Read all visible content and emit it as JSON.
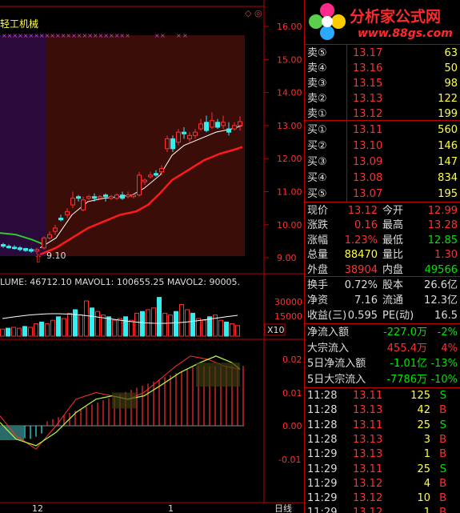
{
  "stock_name": "轻工机械",
  "logo": {
    "title": "分析家公式网",
    "url": "www.88gs.com"
  },
  "price_axis": [
    "16.00",
    "15.00",
    "14.00",
    "13.00",
    "12.00",
    "11.00",
    "10.00",
    "9.00"
  ],
  "low_marker": "9.10",
  "volume_header": "LUME: 46712.10  MAVOL1: 100655.25  MAVOL2: 90005.",
  "volume_axis": [
    "30000",
    "15000"
  ],
  "volume_unit": "X10",
  "indicator_axis": [
    "0.02",
    "0.01",
    "0.00",
    "-0.01"
  ],
  "date_labels": [
    "12",
    "1"
  ],
  "period_label": "日线",
  "order_book": {
    "asks": [
      {
        "label": "卖⑤",
        "price": "13.17",
        "vol": "63"
      },
      {
        "label": "卖④",
        "price": "13.16",
        "vol": "50"
      },
      {
        "label": "卖③",
        "price": "13.15",
        "vol": "98"
      },
      {
        "label": "卖②",
        "price": "13.13",
        "vol": "122"
      },
      {
        "label": "卖①",
        "price": "13.12",
        "vol": "199"
      }
    ],
    "bids": [
      {
        "label": "买①",
        "price": "13.11",
        "vol": "560"
      },
      {
        "label": "买②",
        "price": "13.10",
        "vol": "146"
      },
      {
        "label": "买③",
        "price": "13.09",
        "vol": "147"
      },
      {
        "label": "买④",
        "price": "13.08",
        "vol": "834"
      },
      {
        "label": "买⑤",
        "price": "13.07",
        "vol": "195"
      }
    ]
  },
  "quote": [
    {
      "l1": "现价",
      "v1": "13.12",
      "l2": "今开",
      "v2": "12.99"
    },
    {
      "l1": "涨跌",
      "v1": "0.16",
      "l2": "最高",
      "v2": "13.28"
    },
    {
      "l1": "涨幅",
      "v1": "1.23%",
      "l2": "最低",
      "v2": "12.85"
    },
    {
      "l1": "总量",
      "v1": "88470",
      "l2": "量比",
      "v2": "1.30"
    },
    {
      "l1": "外盘",
      "v1": "38904",
      "l2": "内盘",
      "v2": "49566"
    }
  ],
  "fundamentals": [
    {
      "l1": "换手",
      "v1": "0.72%",
      "l2": "股本",
      "v2": "26.6亿"
    },
    {
      "l1": "净资",
      "v1": "7.16",
      "l2": "流通",
      "v2": "12.3亿"
    },
    {
      "l1": "收益(三)",
      "v1": "0.595",
      "l2": "PE(动)",
      "v2": "16.5"
    }
  ],
  "flows": [
    {
      "label": "净流入额",
      "value": "-227.0万",
      "pct": "-2%"
    },
    {
      "label": "大宗流入",
      "value": "455.4万",
      "pct": "4%"
    },
    {
      "label": "5日净流入额",
      "value": "-1.01亿",
      "pct": "-13%"
    },
    {
      "label": "5日大宗流入",
      "value": "-7786万",
      "pct": "-10%"
    }
  ],
  "ticks": [
    {
      "time": "11:28",
      "price": "13.11",
      "vol": "125",
      "side": "S"
    },
    {
      "time": "11:28",
      "price": "13.13",
      "vol": "42",
      "side": "B"
    },
    {
      "time": "11:28",
      "price": "13.11",
      "vol": "25",
      "side": "S"
    },
    {
      "time": "11:28",
      "price": "13.13",
      "vol": "3",
      "side": "B"
    },
    {
      "time": "11:29",
      "price": "13.13",
      "vol": "1",
      "side": "B"
    },
    {
      "time": "11:29",
      "price": "13.11",
      "vol": "25",
      "side": "S"
    },
    {
      "time": "11:29",
      "price": "13.12",
      "vol": "4",
      "side": "B"
    },
    {
      "time": "11:29",
      "price": "13.12",
      "vol": "10",
      "side": "B"
    },
    {
      "time": "11:29",
      "price": "13.12",
      "vol": "1",
      "side": "B"
    }
  ],
  "colors": {
    "up": "#ff3030",
    "down": "#3ee",
    "ma1": "#ffffff",
    "ma2": "#ff1a1a",
    "bg_red": "#3a0d08",
    "bg_purple": "#2a0a3a"
  }
}
